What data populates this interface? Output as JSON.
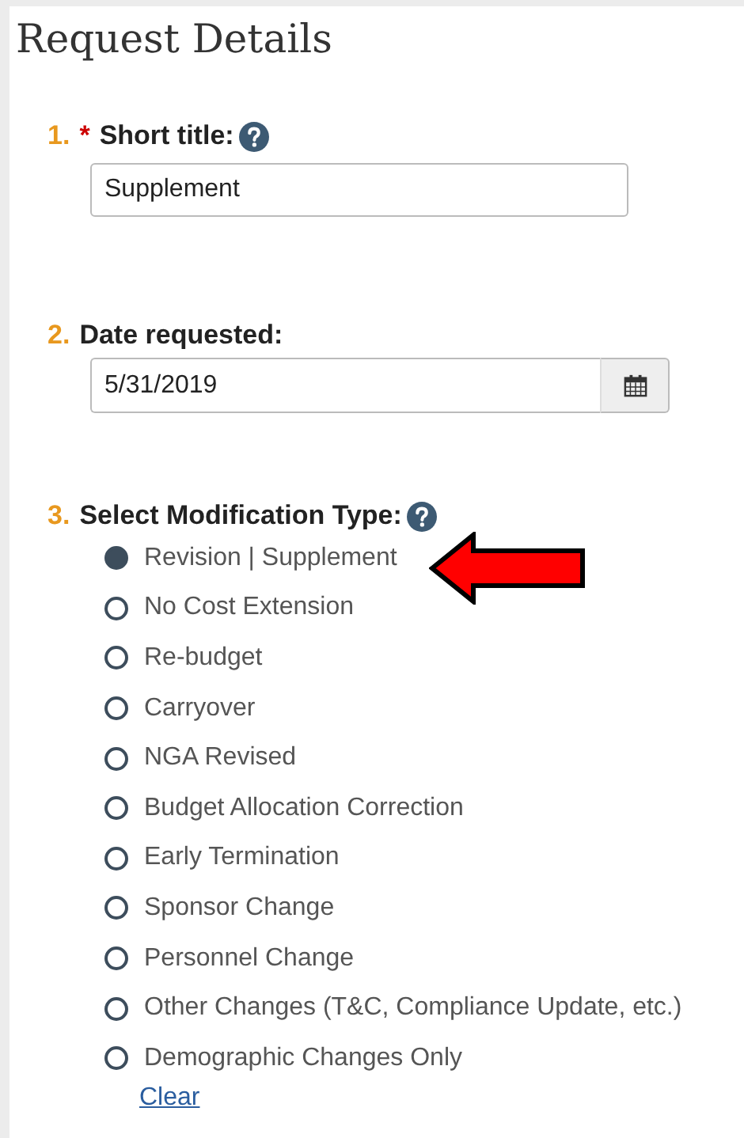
{
  "heading": "Request Details",
  "questions": [
    {
      "kind": "text",
      "number": "1.",
      "marker": "*",
      "label": "Short title:",
      "help": true,
      "value": "Supplement"
    },
    {
      "kind": "date",
      "number": "2.",
      "label": "Date requested:",
      "help": false,
      "value": "5/31/2019"
    },
    {
      "kind": "radio",
      "number": "3.",
      "label": "Select Modification Type:",
      "help": true,
      "options": [
        {
          "label": "Revision | Supplement",
          "selected": true
        },
        {
          "label": "No Cost Extension",
          "selected": false
        },
        {
          "label": "Re-budget",
          "selected": false
        },
        {
          "label": "Carryover",
          "selected": false
        },
        {
          "label": "NGA Revised",
          "selected": false
        },
        {
          "label": "Budget Allocation Correction",
          "selected": false
        },
        {
          "label": "Early Termination",
          "selected": false
        },
        {
          "label": "Sponsor Change",
          "selected": false
        },
        {
          "label": "Personnel Change",
          "selected": false
        },
        {
          "label": "Other Changes (T&C, Compliance Update, etc.)",
          "selected": false
        },
        {
          "label": "Demographic Changes Only",
          "selected": false
        }
      ],
      "clear": "Clear"
    }
  ]
}
